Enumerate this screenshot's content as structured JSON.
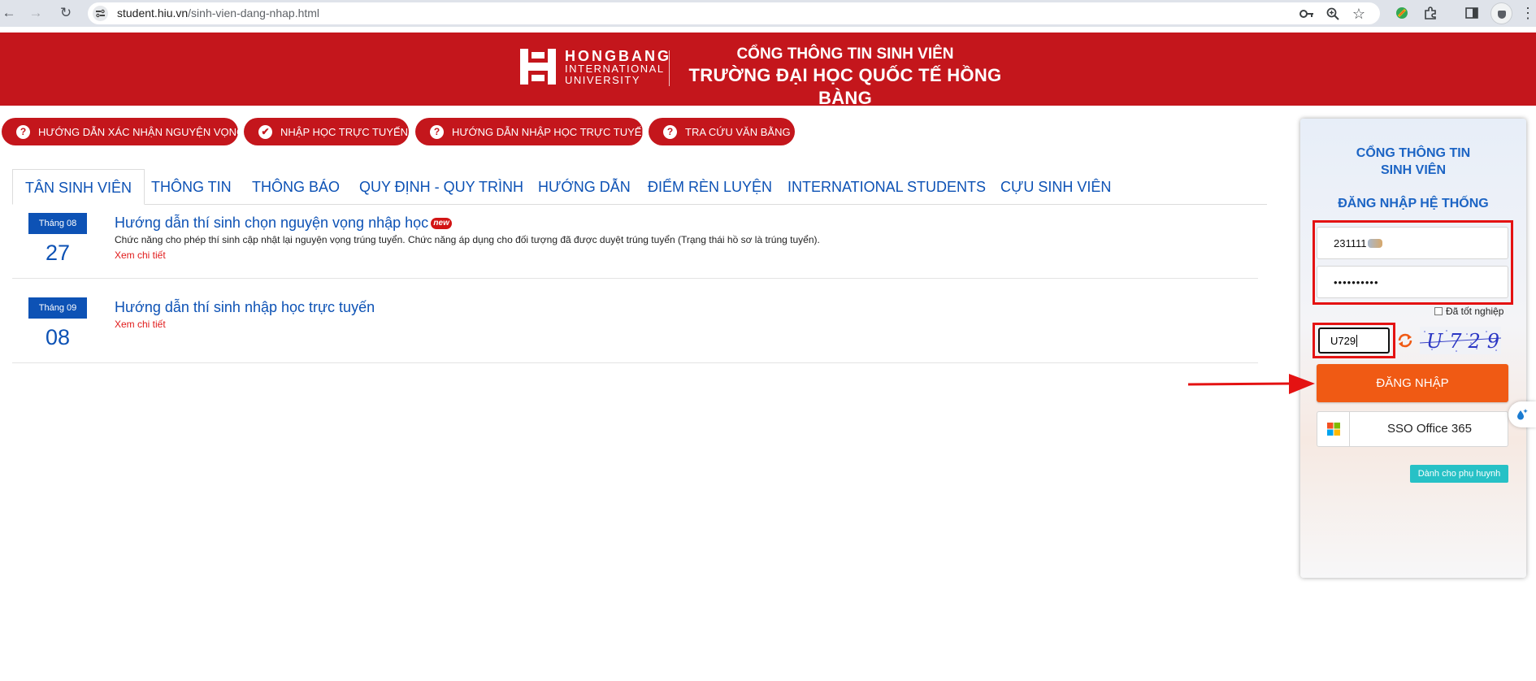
{
  "browser": {
    "url_domain": "student.hiu.vn",
    "url_path": "/sinh-vien-dang-nhap.html",
    "icons": [
      "back-arrow",
      "forward-arrow",
      "reload",
      "site-settings",
      "password-key",
      "zoom",
      "bookmark-star",
      "extension-brush",
      "extensions-puzzle",
      "side-panel",
      "profile-avatar",
      "menu-dots"
    ]
  },
  "header": {
    "logo_line1": "HONGBANG",
    "logo_line2": "INTERNATIONAL",
    "logo_line3": "UNIVERSITY",
    "title_line1": "CỔNG THÔNG TIN SINH VIÊN",
    "title_line2": "TRƯỜNG ĐẠI HỌC QUỐC TẾ HỒNG BÀNG",
    "brand_color": "#c4161c"
  },
  "quick_links": [
    {
      "icon": "?",
      "label": "HƯỚNG DẪN XÁC NHẬN NGUYỆN VỌNG"
    },
    {
      "icon": "✔",
      "label": "NHẬP HỌC TRỰC TUYẾN"
    },
    {
      "icon": "?",
      "label": "HƯỚNG DẪN NHẬP HỌC TRỰC TUYẾN"
    },
    {
      "icon": "?",
      "label": "TRA CỨU VĂN BẰNG"
    }
  ],
  "tabs": [
    {
      "label": "TÂN SINH VIÊN",
      "active": true
    },
    {
      "label": "THÔNG TIN"
    },
    {
      "label": "THÔNG BÁO"
    },
    {
      "label": "QUY ĐỊNH - QUY TRÌNH"
    },
    {
      "label": "HƯỚNG DẪN"
    },
    {
      "label": "ĐIỂM RÈN LUYỆN"
    },
    {
      "label": "INTERNATIONAL STUDENTS"
    },
    {
      "label": "CỰU SINH VIÊN"
    }
  ],
  "news": [
    {
      "month": "Tháng 08",
      "day": "27",
      "title": "Hướng dẫn thí sinh chọn nguyện vọng nhập học",
      "badge": "new",
      "description": "Chức năng cho phép thí sinh cập nhật lại nguyện vọng trúng tuyển. Chức năng áp dụng cho đối tượng đã được duyệt trúng tuyển (Trạng thái hồ sơ là trúng tuyển).",
      "more": "Xem chi tiết"
    },
    {
      "month": "Tháng 09",
      "day": "08",
      "title": "Hướng dẫn thí sinh nhập học trực tuyến",
      "more": "Xem chi tiết"
    }
  ],
  "login": {
    "heading_line1": "CỔNG THÔNG TIN",
    "heading_line2": "SINH VIÊN",
    "subheading": "ĐĂNG NHẬP HỆ THỐNG",
    "username_value": "231111",
    "password_value": "••••••••••",
    "graduated_label": "Đã tốt nghiệp",
    "graduated_checked": false,
    "captcha_value": "U729",
    "captcha_image_text": "U729",
    "login_button": "ĐĂNG NHẬP",
    "sso_button": "SSO Office 365",
    "parent_button": "Dành cho phụ huynh",
    "accent": "#f05a14",
    "heading_color": "#1c64c4"
  }
}
